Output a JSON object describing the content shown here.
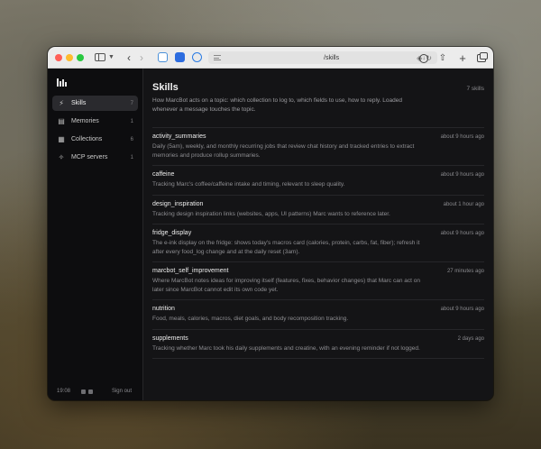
{
  "browser": {
    "url": "/skills"
  },
  "sidebar": {
    "items": [
      {
        "label": "Skills",
        "count": "7",
        "icon": "bolt-icon",
        "active": true
      },
      {
        "label": "Memories",
        "count": "1",
        "icon": "document-icon",
        "active": false
      },
      {
        "label": "Collections",
        "count": "6",
        "icon": "table-icon",
        "active": false
      },
      {
        "label": "MCP servers",
        "count": "1",
        "icon": "plug-icon",
        "active": false
      }
    ],
    "footer": {
      "time": "19:08",
      "signout_label": "Sign out"
    }
  },
  "main": {
    "title": "Skills",
    "count_label": "7 skills",
    "description": "How MarcBot acts on a topic: which collection to log to, which fields to use, how to reply. Loaded whenever a message touches the topic.",
    "skills": [
      {
        "name": "activity_summaries",
        "time": "about 9 hours ago",
        "description": "Daily (5am), weekly, and monthly recurring jobs that review chat history and tracked entries to extract memories and produce rollup summaries."
      },
      {
        "name": "caffeine",
        "time": "about 9 hours ago",
        "description": "Tracking Marc's coffee/caffeine intake and timing, relevant to sleep quality."
      },
      {
        "name": "design_inspiration",
        "time": "about 1 hour ago",
        "description": "Tracking design inspiration links (websites, apps, UI patterns) Marc wants to reference later."
      },
      {
        "name": "fridge_display",
        "time": "about 9 hours ago",
        "description": "The e-ink display on the fridge: shows today's macros card (calories, protein, carbs, fat, fiber); refresh it after every food_log change and at the daily reset (3am)."
      },
      {
        "name": "marcbot_self_improvement",
        "time": "27 minutes ago",
        "description": "Where MarcBot notes ideas for improving itself (features, fixes, behavior changes) that Marc can act on later since MarcBot cannot edit its own code yet."
      },
      {
        "name": "nutrition",
        "time": "about 9 hours ago",
        "description": "Food, meals, calories, macros, diet goals, and body recomposition tracking."
      },
      {
        "name": "supplements",
        "time": "2 days ago",
        "description": "Tracking whether Marc took his daily supplements and creatine, with an evening reminder if not logged."
      }
    ]
  }
}
